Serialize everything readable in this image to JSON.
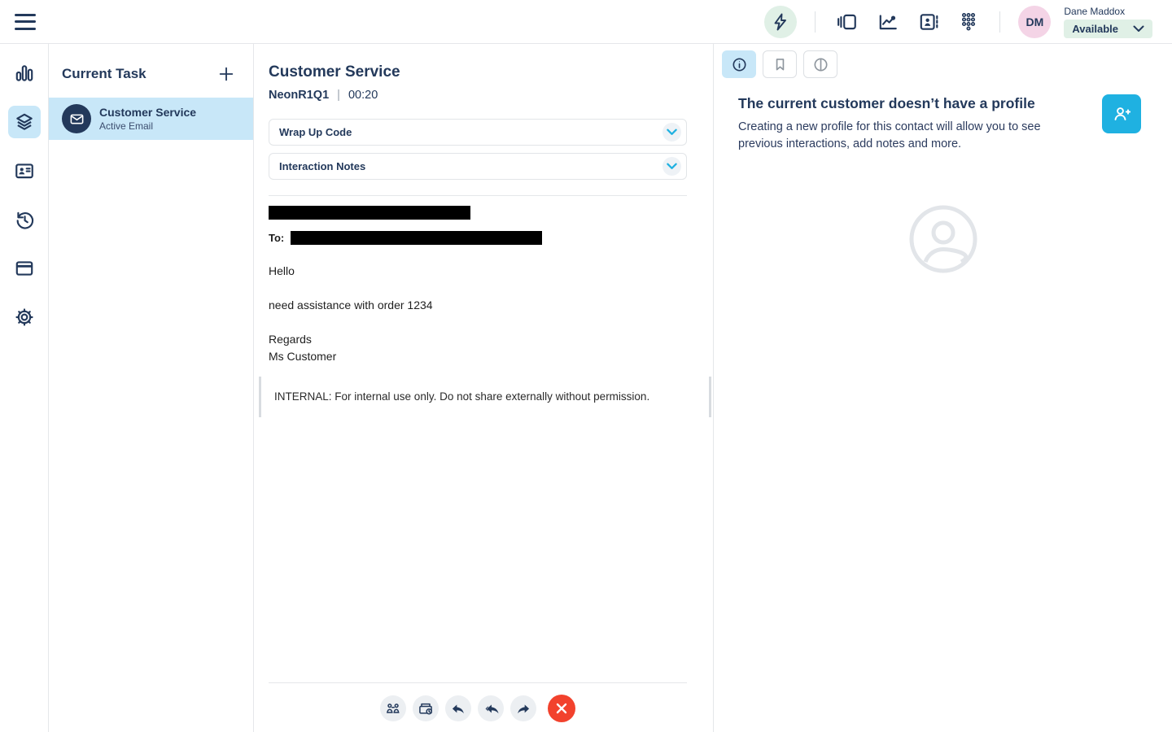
{
  "topbar": {
    "icons": [
      "menu-hamburger",
      "interactions-bolt",
      "panels",
      "performance-chart",
      "contacts-card",
      "dialpad"
    ],
    "user": {
      "initials": "DM",
      "name": "Dane Maddox",
      "status": "Available"
    }
  },
  "rail": {
    "icons": [
      "activity-bars",
      "tasks-layers",
      "directory-card",
      "history-clock",
      "browser-window",
      "settings-gear"
    ],
    "active_icon": "tasks-layers"
  },
  "task_panel": {
    "title": "Current Task",
    "tasks": [
      {
        "name": "Customer Service",
        "status": "Active Email",
        "icon": "email-envelope",
        "selected": true
      }
    ]
  },
  "main": {
    "title": "Customer Service",
    "queue": "NeonR1Q1",
    "separator": "|",
    "timer": "00:20",
    "wrap_up_label": "Wrap Up Code",
    "notes_label": "Interaction Notes",
    "email": {
      "to_label": "To:",
      "body_lines": [
        "Hello",
        "need assistance with order 1234",
        "Regards",
        "Ms Customer"
      ],
      "internal_note": "INTERNAL: For internal use only. Do not share externally without permission."
    },
    "toolbar_icons": [
      "transfer-agents",
      "park-email",
      "reply",
      "reply-all",
      "forward",
      "disconnect-x"
    ]
  },
  "right_panel": {
    "tabs": [
      "profile-info",
      "bookmark",
      "journey"
    ],
    "active_tab": "profile-info",
    "heading": "The current customer doesn’t have a profile",
    "description": "Creating a new profile for this contact will allow you to see previous interactions, add notes and more.",
    "action_icon": "person-add",
    "placeholder_icon": "profile-placeholder"
  },
  "colors": {
    "navy": "#23395B",
    "selection_blue": "#C8E7F8",
    "accent_cyan": "#1FB1E1",
    "mint": "#E0F0E6",
    "avatar_pink": "#F4D4E6",
    "danger_red": "#F2422D",
    "border": "#E5E7EA",
    "placeholder_gray": "#E2E5E9"
  }
}
